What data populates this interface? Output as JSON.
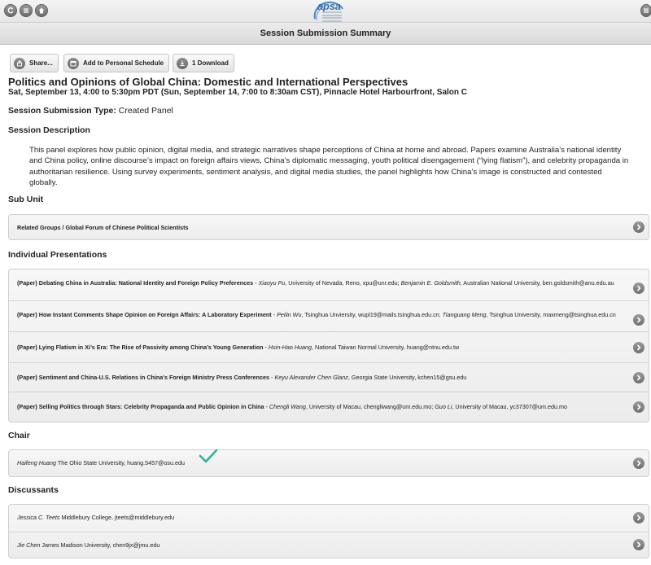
{
  "header": {
    "logo_text": "apsa",
    "title": "Session Submission Summary"
  },
  "toolbar": {
    "share_label": "Share...",
    "schedule_label": "Add to Personal Schedule",
    "download_label": "1 Download"
  },
  "session": {
    "title": "Politics and Opinions of Global China: Domestic and International Perspectives",
    "time_location": "Sat, September 13, 4:00 to 5:30pm PDT (Sun, September 14, 7:00 to 8:30am CST), Pinnacle Hotel Harbourfront, Salon C",
    "type_label": "Session Submission Type:",
    "type_value": "Created Panel",
    "description_heading": "Session Description",
    "description": "This panel explores how public opinion, digital media, and strategic narratives shape perceptions of China at home and abroad. Papers examine Australia’s national identity and China policy, online discourse’s impact on foreign affairs views, China’s diplomatic messaging, youth political disengagement (“lying flatism”), and celebrity propaganda in authoritarian resilience. Using survey experiments, sentiment analysis, and digital media studies, the panel highlights how China’s image is constructed and contested globally."
  },
  "sub_unit": {
    "heading": "Sub Unit",
    "item": "Related Groups / Global Forum of Chinese Political Scientists"
  },
  "presentations": {
    "heading": "Individual Presentations",
    "items": [
      {
        "title": "(Paper) Debating China in Australia: National Identity and Foreign Policy Preferences",
        "a1": "Xiaoyu Pu",
        "a1_info": ", University of Nevada, Reno, xpu@unr.edu; ",
        "a2": "Benjamin E. Goldsmith",
        "a2_info": ", Australian National University, ben.goldsmith@anu.edu.au"
      },
      {
        "title": "(Paper) How Instant Comments Shape Opinion on Foreign Affairs: A Laboratory Experiment",
        "a1": "Peilin Wu",
        "a1_info": ", Tsinghua Unviersity, wupl19@mails.tsinghua.edu.cn; ",
        "a2": "Tianguang Meng",
        "a2_info": ", Tsinghua University, maxmeng@tsinghua.edu.cn"
      },
      {
        "title": "(Paper) Lying Flatism in Xi’s Era: The Rise of Passivity among China’s Young Generation",
        "a1": "Hsin-Hao Huang",
        "a1_info": ", National Taiwan Normal University, huang@ntnu.edu.tw",
        "a2": "",
        "a2_info": ""
      },
      {
        "title": "(Paper) Sentiment and China-U.S. Relations in China's Foreign Ministry Press Conferences",
        "a1": "Keyu Alexander Chen Glanz",
        "a1_info": ", Georgia State University, kchen15@gsu.edu",
        "a2": "",
        "a2_info": ""
      },
      {
        "title": "(Paper) Selling Politics through Stars: Celebrity Propaganda and Public Opinion in China",
        "a1": "Chengli Wang",
        "a1_info": ", University of Macau, chengliwang@um.edu.mo; ",
        "a2": "Guo Li",
        "a2_info": ", University of Macau, yc37307@um.edu.mo"
      }
    ]
  },
  "chair": {
    "heading": "Chair",
    "name": "Haifeng Huang",
    "info": " The Ohio State University, huang.5457@osu.edu"
  },
  "discussants": {
    "heading": "Discussants",
    "items": [
      {
        "name": "Jessica C. Teets",
        "info": " Middlebury College, jteets@middlebury.edu"
      },
      {
        "name": "Jie Chen",
        "info": " James Madison University, chen9jx@jmu.edu"
      }
    ]
  },
  "colors": {
    "brand": "#2e6fa8",
    "checkmark": "#2bb59a"
  }
}
